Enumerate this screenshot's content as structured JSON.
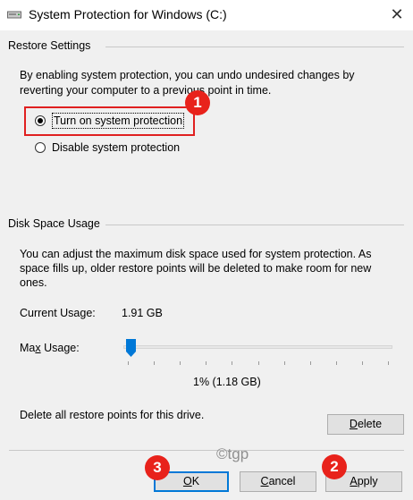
{
  "window": {
    "title": "System Protection for Windows (C:)",
    "close_glyph": "✕"
  },
  "restore_settings": {
    "group_label": "Restore Settings",
    "description_line1": "By enabling system protection, you can undo undesired changes by",
    "description_line2": "reverting your computer to a previous point in time.",
    "option_on": "Turn on system protection",
    "option_off": "Disable system protection",
    "selected": "on"
  },
  "disk_space": {
    "group_label": "Disk Space Usage",
    "description_line1": "You can adjust the maximum disk space used for system protection. As",
    "description_line2": "space fills up, older restore points will be deleted to make room for new",
    "description_line3": "ones.",
    "current_usage_label": "Current Usage:",
    "current_usage_value": "1.91 GB",
    "max_usage_label_pre": "Ma",
    "max_usage_label_accel": "x",
    "max_usage_label_post": " Usage:",
    "max_usage_percent": 1,
    "max_usage_value": "1% (1.18 GB)",
    "delete_text": "Delete all restore points for this drive.",
    "delete_button_accel": "D",
    "delete_button_rest": "elete"
  },
  "buttons": {
    "ok_accel": "O",
    "ok_rest": "K",
    "cancel_accel": "C",
    "cancel_rest": "ancel",
    "apply_accel": "A",
    "apply_rest": "pply"
  },
  "annotations": {
    "badge1": "1",
    "badge2": "2",
    "badge3": "3",
    "highlight_color": "#e02020",
    "badge_color": "#e8221b"
  },
  "watermark": "©tgp"
}
